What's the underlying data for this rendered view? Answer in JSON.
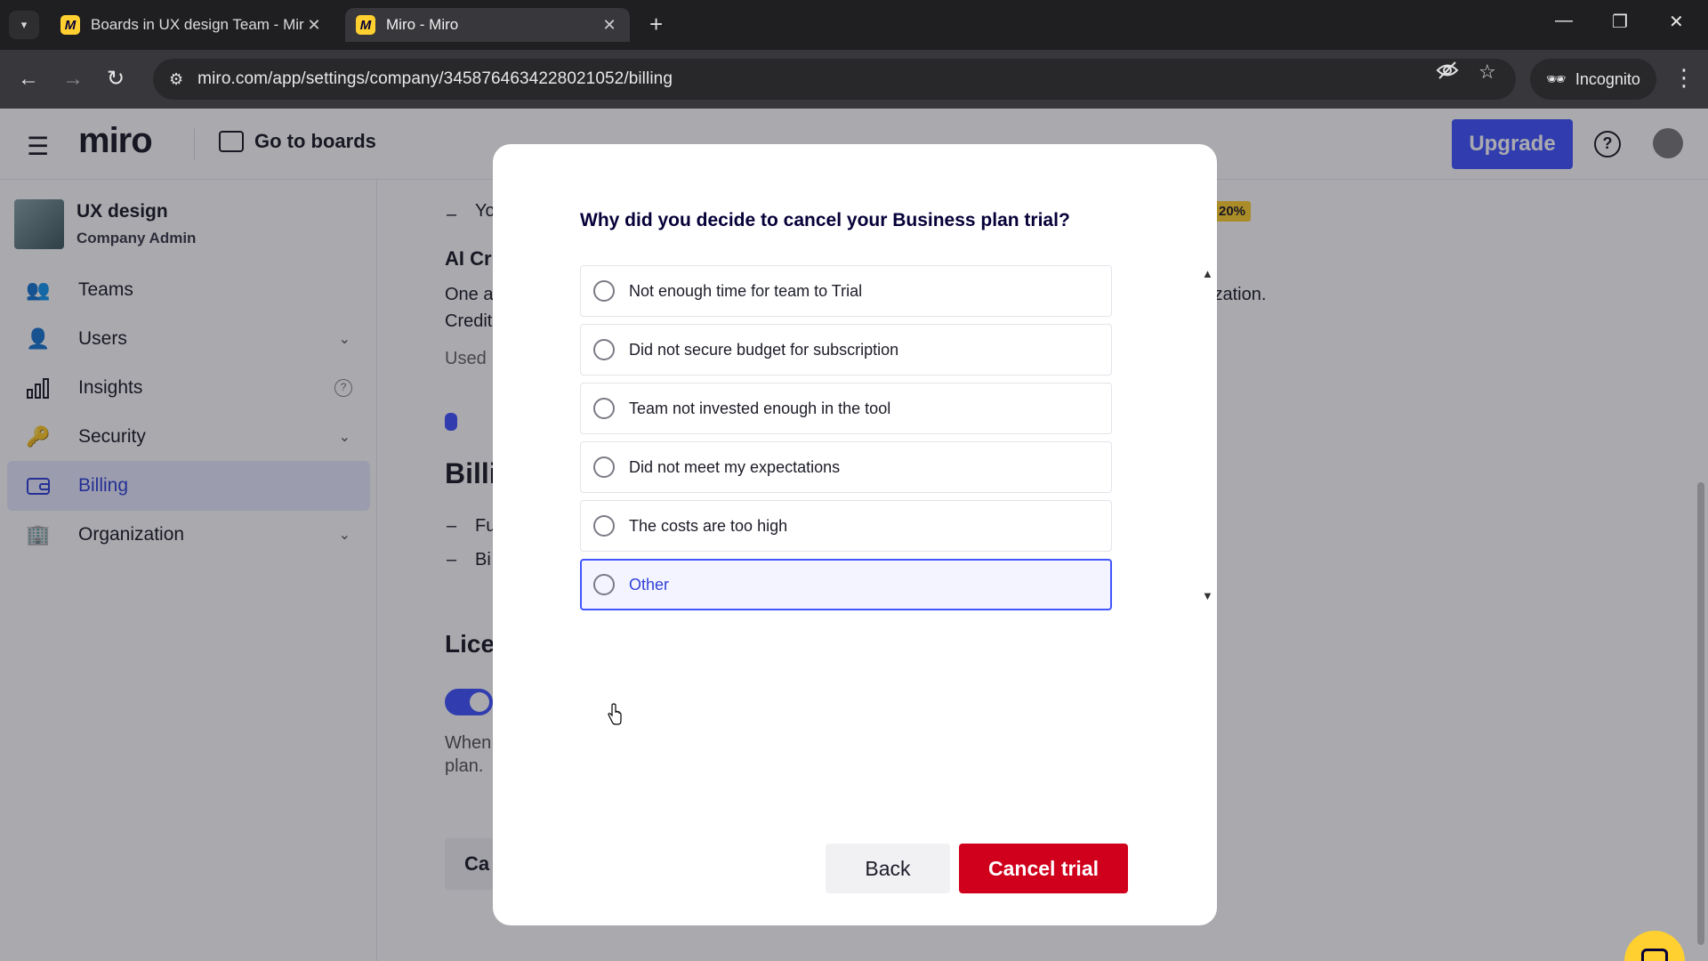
{
  "browser": {
    "tab_search_icon": "chevron-down-icon",
    "tabs": [
      {
        "title": "Boards in UX design Team - Mir",
        "favicon": "M"
      },
      {
        "title": "Miro - Miro",
        "favicon": "M"
      }
    ],
    "new_tab": "+",
    "window": {
      "minimize": "—",
      "restore": "❐",
      "close": "✕"
    },
    "url": "miro.com/app/settings/company/3458764634228021052/billing",
    "incognito_label": "Incognito"
  },
  "app": {
    "logo": "miro",
    "go_to_boards": "Go to boards",
    "upgrade": "Upgrade",
    "help": "?"
  },
  "sidebar": {
    "workspace_name": "UX design",
    "workspace_role": "Company Admin",
    "items": [
      {
        "label": "Teams",
        "icon": "teams-icon",
        "chevron": false
      },
      {
        "label": "Users",
        "icon": "user-icon",
        "chevron": true
      },
      {
        "label": "Insights",
        "icon": "bar-chart-icon",
        "info": true
      },
      {
        "label": "Security",
        "icon": "key-icon",
        "chevron": true
      },
      {
        "label": "Billing",
        "icon": "wallet-icon",
        "active": true
      },
      {
        "label": "Organization",
        "icon": "building-icon",
        "chevron": true
      }
    ]
  },
  "background_content": {
    "dash1": "–",
    "yo_text": "Yo",
    "badge": "20%",
    "ai_heading": "AI Cr",
    "one_text": "One a",
    "credit_text": "Credit",
    "ization_text": "ization.",
    "used_text": "Used",
    "billing_heading": "Billi",
    "fu_text": "Fu",
    "bi_text": "Bi",
    "license_heading": "Lice",
    "when_text": "When",
    "plan_text": "plan.",
    "cancel_partial": "Ca"
  },
  "modal": {
    "question": "Why did you decide to cancel your Business plan trial?",
    "options": [
      "Not enough time for team to Trial",
      "Did not secure budget for subscription",
      "Team not invested enough in the tool",
      "Did not meet my expectations",
      "The costs are too high",
      "Other"
    ],
    "hovered_option_index": 5,
    "back_label": "Back",
    "cancel_label": "Cancel trial"
  },
  "colors": {
    "accent": "#4255ff",
    "danger": "#d0001c",
    "brand_yellow": "#ffd02f"
  }
}
